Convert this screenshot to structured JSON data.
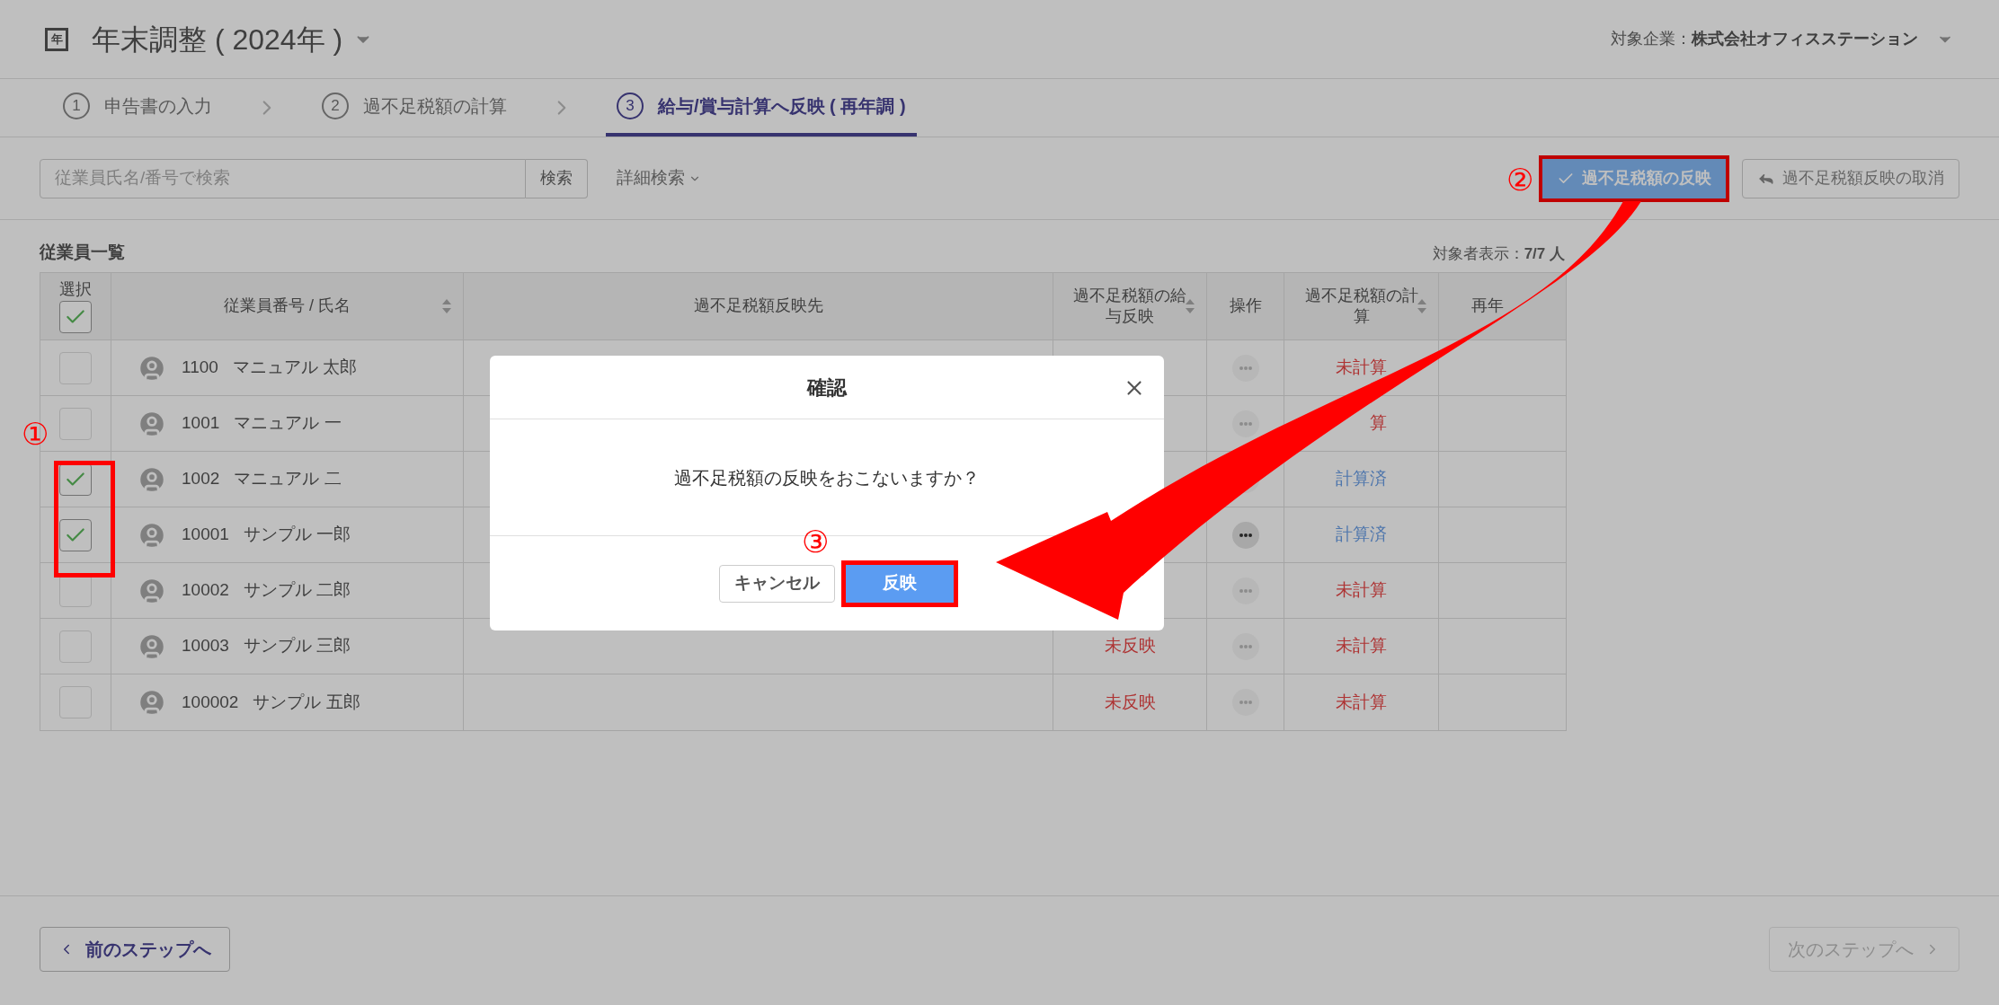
{
  "header": {
    "icon_text": "年",
    "title": "年末調整 ( 2024年 )",
    "company_label": "対象企業：",
    "company": "株式会社オフィスステーション"
  },
  "steps": [
    {
      "number": "1",
      "label": "申告書の入力",
      "selected": false
    },
    {
      "number": "2",
      "label": "過不足税額の計算",
      "selected": false
    },
    {
      "number": "3",
      "label": "給与/賞与計算へ反映 ( 再年調 )",
      "selected": true
    }
  ],
  "search": {
    "placeholder": "従業員氏名/番号で検索",
    "button": "検索",
    "advanced": "詳細検索"
  },
  "actions": [
    {
      "kind": "primary",
      "label": "過不足税額の反映"
    },
    {
      "kind": "secondary",
      "label": "過不足税額反映の取消"
    }
  ],
  "list": {
    "title": "従業員一覧",
    "count_label": "対象者表示：",
    "count": "7/7 人"
  },
  "table": {
    "select_all_checked": true,
    "columns": [
      {
        "label": "選択",
        "sortable": false
      },
      {
        "label": "従業員番号 / 氏名",
        "sortable": true
      },
      {
        "label": "過不足税額反映先",
        "sortable": false
      },
      {
        "label": "過不足税額の給与反映",
        "sortable": true
      },
      {
        "label": "操作",
        "sortable": false
      },
      {
        "label": "過不足税額の計算",
        "sortable": true
      },
      {
        "label": "再年",
        "sortable": false
      }
    ],
    "rows": [
      {
        "checked": false,
        "number": "1100",
        "name": "マニュアル 太郎",
        "menu_highlighted": false,
        "calc": {
          "text": "未計算",
          "calculated": false
        }
      },
      {
        "checked": false,
        "number": "1001",
        "name": "マニュアル 一",
        "menu_highlighted": false,
        "calc": {
          "text": "算",
          "calculated": false
        }
      },
      {
        "checked": true,
        "number": "1002",
        "name": "マニュアル 二",
        "menu_highlighted": false,
        "calc": {
          "text": "計算済",
          "calculated": true
        }
      },
      {
        "checked": true,
        "number": "10001",
        "name": "サンプル 一郎",
        "menu_highlighted": true,
        "calc": {
          "text": "計算済",
          "calculated": true
        }
      },
      {
        "checked": false,
        "number": "10002",
        "name": "サンプル 二郎",
        "menu_highlighted": false,
        "calc": {
          "text": "未計算",
          "calculated": false
        }
      },
      {
        "checked": false,
        "number": "10003",
        "name": "サンプル 三郎",
        "reflection": "未反映",
        "menu_highlighted": false,
        "calc": {
          "text": "未計算",
          "calculated": false
        }
      },
      {
        "checked": false,
        "number": "100002",
        "name": "サンプル 五郎",
        "reflection": "未反映",
        "menu_highlighted": false,
        "calc": {
          "text": "未計算",
          "calculated": false
        }
      }
    ]
  },
  "footer": [
    {
      "label": "前のステップへ",
      "kind": "back",
      "disabled": false
    },
    {
      "label": "次のステップへ",
      "kind": "next",
      "disabled": true
    }
  ],
  "dialog": {
    "title": "確認",
    "message": "過不足税額の反映をおこないますか？",
    "cancel": "キャンセル",
    "confirm": "反映"
  },
  "annotations": [
    "①",
    "②",
    "③"
  ]
}
